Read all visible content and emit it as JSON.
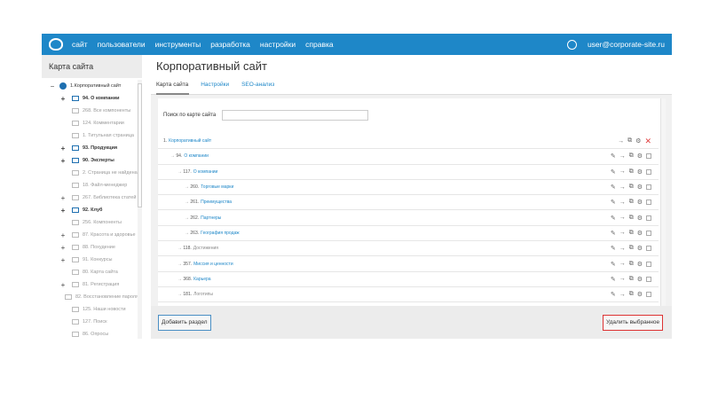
{
  "header": {
    "nav": [
      "сайт",
      "пользователи",
      "инструменты",
      "разработка",
      "настройки",
      "справка"
    ],
    "user": "user@corporate-site.ru"
  },
  "sidebar": {
    "title": "Карта сайта",
    "items": [
      {
        "label": "1.Корпоративный сайт",
        "pm": "−",
        "icon": "globe",
        "lvl": 0,
        "bold": false
      },
      {
        "label": "94. О компании",
        "pm": "+",
        "lvl": 1,
        "bold": true
      },
      {
        "label": "268. Все компоненты",
        "pm": "",
        "lvl": 1,
        "bold": false
      },
      {
        "label": "124. Комментарии",
        "pm": "",
        "lvl": 1,
        "bold": false
      },
      {
        "label": "1. Титульная страница",
        "pm": "",
        "lvl": 1,
        "bold": false
      },
      {
        "label": "93. Продукция",
        "pm": "+",
        "lvl": 1,
        "bold": true
      },
      {
        "label": "90. Эксперты",
        "pm": "+",
        "lvl": 1,
        "bold": true
      },
      {
        "label": "2. Страница не найдена",
        "pm": "",
        "lvl": 1,
        "bold": false
      },
      {
        "label": "18. Файл-менеджер",
        "pm": "",
        "lvl": 1,
        "bold": false
      },
      {
        "label": "267. Библиотека статей",
        "pm": "+",
        "lvl": 1,
        "bold": false
      },
      {
        "label": "92. Клуб",
        "pm": "+",
        "lvl": 1,
        "bold": true
      },
      {
        "label": "256. Компоненты",
        "pm": "",
        "lvl": 1,
        "bold": false
      },
      {
        "label": "87. Красота и здоровье",
        "pm": "+",
        "lvl": 1,
        "bold": false
      },
      {
        "label": "88. Похудение",
        "pm": "+",
        "lvl": 1,
        "bold": false
      },
      {
        "label": "91. Конкурсы",
        "pm": "+",
        "lvl": 1,
        "bold": false
      },
      {
        "label": "80. Карта сайта",
        "pm": "",
        "lvl": 1,
        "bold": false
      },
      {
        "label": "81. Регистрация",
        "pm": "+",
        "lvl": 1,
        "bold": false
      },
      {
        "label": "82. Восстановление пароля",
        "pm": "",
        "lvl": 1,
        "bold": false
      },
      {
        "label": "125. Наши новости",
        "pm": "",
        "lvl": 1,
        "bold": false
      },
      {
        "label": "127. Поиск",
        "pm": "",
        "lvl": 1,
        "bold": false
      },
      {
        "label": "86. Опросы",
        "pm": "",
        "lvl": 1,
        "bold": false
      }
    ]
  },
  "main": {
    "title": "Корпоративный сайт",
    "tabs": [
      "Карта сайта",
      "Настройки",
      "SEO-анализ"
    ],
    "search_label": "Поиск по карте сайта",
    "rows": [
      {
        "num": "1.",
        "label": "Корпоративный сайт",
        "lvl": 0,
        "root": true
      },
      {
        "num": "94.",
        "label": "О компании",
        "lvl": 1
      },
      {
        "num": "117.",
        "label": "О компании",
        "lvl": 2
      },
      {
        "num": "260.",
        "label": "Торговые марки",
        "lvl": 3
      },
      {
        "num": "261.",
        "label": "Преимущества",
        "lvl": 3
      },
      {
        "num": "262.",
        "label": "Партнеры",
        "lvl": 3
      },
      {
        "num": "263.",
        "label": "География продаж",
        "lvl": 3
      },
      {
        "num": "118.",
        "label": "Достижения",
        "lvl": 2,
        "gray": true
      },
      {
        "num": "357.",
        "label": "Миссия и ценности",
        "lvl": 2
      },
      {
        "num": "368.",
        "label": "Карьера",
        "lvl": 2
      },
      {
        "num": "181.",
        "label": "Логотипы",
        "lvl": 2,
        "gray": true
      }
    ],
    "add_button": "Добавить раздел",
    "delete_button": "Удалить выбранное"
  }
}
